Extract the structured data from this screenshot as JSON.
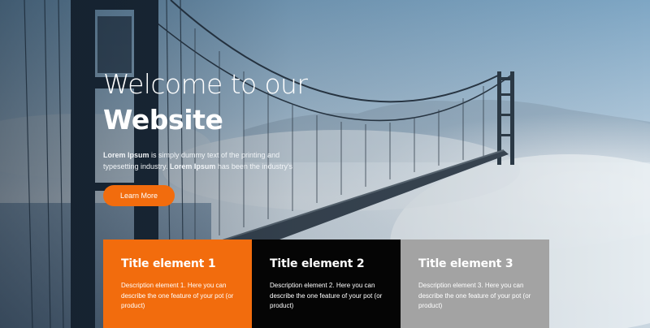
{
  "hero": {
    "headline_light": "Welcome to our",
    "headline_bold": "Website",
    "intro_bold_1": "Lorem Ipsum",
    "intro_text_1": " is simply dummy text of the printing and typesetting industry. ",
    "intro_bold_2": "Lorem Ipsum",
    "intro_text_2": " has been the industry's",
    "cta_label": "Learn More"
  },
  "features": [
    {
      "title": "Title element 1",
      "description": "Description element 1. Here you can describe the one feature of your pot (or product)",
      "color": "#f26c0d"
    },
    {
      "title": "Title element 2",
      "description": "Description element 2. Here you can describe the one feature of your pot (or product)",
      "color": "#050505"
    },
    {
      "title": "Title element 3",
      "description": "Description element 3. Here you can describe the one feature of your pot (or product)",
      "color": "#a3a3a3"
    }
  ],
  "colors": {
    "accent": "#f26c0d",
    "sky": "#8fb3cf",
    "fog": "#dfe6ec",
    "tower": "#1e2b38"
  }
}
